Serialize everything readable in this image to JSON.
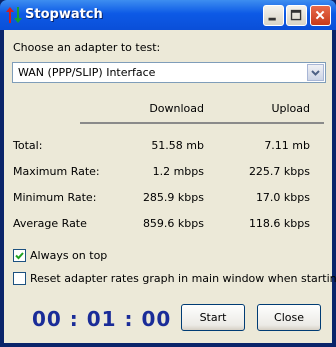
{
  "window": {
    "title": "Stopwatch"
  },
  "adapter": {
    "label": "Choose an adapter to test:",
    "selected": "WAN (PPP/SLIP) Interface"
  },
  "columns": {
    "download": "Download",
    "upload": "Upload"
  },
  "rows": [
    {
      "label": "Total:",
      "download": "51.58 mb",
      "upload": "7.11 mb"
    },
    {
      "label": "Maximum Rate:",
      "download": "1.2 mbps",
      "upload": "225.7 kbps"
    },
    {
      "label": "Minimum Rate:",
      "download": "285.9 kbps",
      "upload": "17.0 kbps"
    },
    {
      "label": "Average Rate",
      "download": "859.6 kbps",
      "upload": "118.6 kbps"
    }
  ],
  "options": {
    "always_on_top": {
      "label": "Always on top",
      "checked": true
    },
    "reset_graph": {
      "label": "Reset adapter rates graph in main window when starting",
      "checked": false
    }
  },
  "timer": "00 : 01 : 00",
  "buttons": {
    "start": "Start",
    "close": "Close"
  },
  "icons": {
    "app": "up-down-arrows-icon",
    "minimize": "minimize-icon",
    "maximize": "maximize-icon",
    "close": "close-icon",
    "dropdown": "chevron-down-icon",
    "check": "checkmark-icon"
  },
  "colors": {
    "titlebar": "#0d5ae6",
    "close_button": "#c73a1a",
    "timer": "#1a2c98",
    "background": "#ece9d8"
  }
}
